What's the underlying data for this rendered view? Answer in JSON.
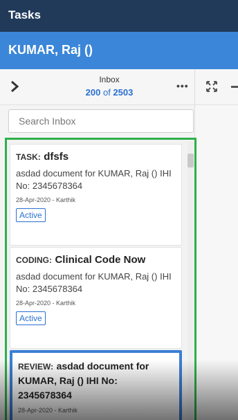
{
  "app": {
    "title": "Tasks"
  },
  "patient": {
    "name": "KUMAR, Raj ()"
  },
  "toolbar": {
    "inbox_label": "Inbox",
    "count_shown": "200",
    "count_of": "of",
    "count_total": "2503"
  },
  "search": {
    "placeholder": "Search Inbox"
  },
  "tasks": [
    {
      "type": "TASK:",
      "subject": "dfsfs",
      "description": "asdad document for KUMAR, Raj () IHI No: 2345678364",
      "meta": "28-Apr-2020 - Karthik",
      "status": "Active"
    },
    {
      "type": "CODING:",
      "subject": "Clinical Code Now",
      "description": "asdad document for KUMAR, Raj () IHI No: 2345678364",
      "meta": "28-Apr-2020 - Karthik",
      "status": "Active"
    },
    {
      "type": "REVIEW:",
      "subject": "asdad document for KUMAR, Raj () IHI No: 2345678364",
      "meta": "28-Apr-2020 - Karthik"
    }
  ],
  "colors": {
    "header_bg": "#213a5a",
    "patient_bar_bg": "#3b86d8",
    "accent": "#2a6fd0",
    "selection_outline": "#2db04a"
  }
}
